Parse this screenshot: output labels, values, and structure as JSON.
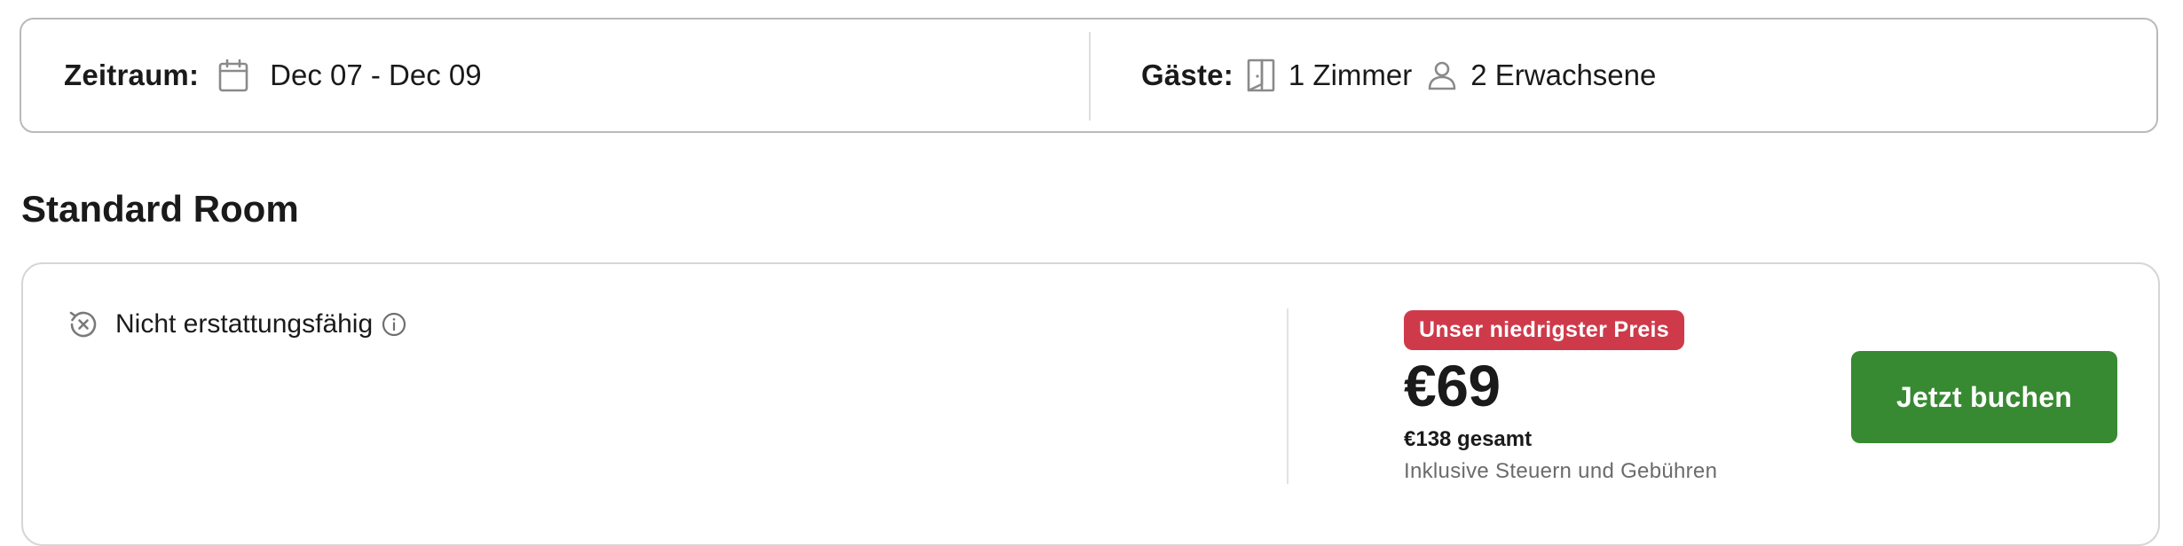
{
  "search_summary": {
    "dates": {
      "label": "Zeitraum:",
      "value": "Dec 07 - Dec 09",
      "icon": "calendar-icon"
    },
    "guests": {
      "label": "Gäste:",
      "rooms": "1 Zimmer",
      "rooms_icon": "door-icon",
      "adults": "2 Erwachsene",
      "adults_icon": "person-icon"
    }
  },
  "room": {
    "title": "Standard Room",
    "rate": {
      "policy": "Nicht erstattungsfähig",
      "policy_icon": "non-refundable-icon",
      "info_icon": "info-icon",
      "badge": "Unser niedrigster Preis",
      "price_per_night": "€69",
      "price_total": "€138 gesamt",
      "price_note": "Inklusive Steuern und Gebühren",
      "book_label": "Jetzt buchen"
    }
  },
  "colors": {
    "badge_background": "#cf3a4b",
    "book_button": "#378a31",
    "border": "#b9b9b9",
    "muted_text": "#6b6b6b",
    "icon_gray": "#8a8a8a"
  }
}
